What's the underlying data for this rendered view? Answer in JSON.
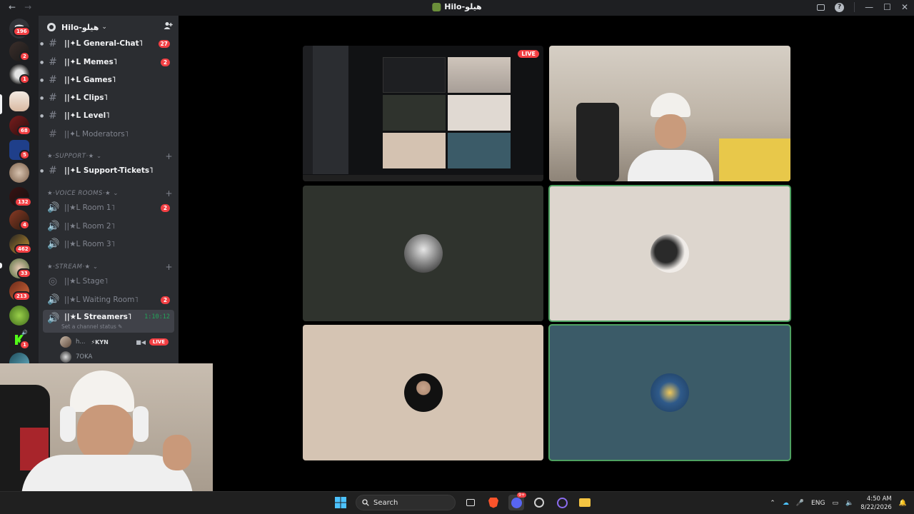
{
  "window": {
    "title": "Hilo-هيلو",
    "back": "←",
    "forward": "→",
    "controls": {
      "minimize": "—",
      "maximize": "☐",
      "close": "✕",
      "help": "?"
    }
  },
  "rail": {
    "badges": [
      "196",
      "2",
      "1",
      "68",
      "5",
      "132",
      "4",
      "462",
      "33",
      "213",
      "1"
    ]
  },
  "server": {
    "name": "Hilo-هيلو",
    "chevron": "⌄",
    "invite_icon": "👤+"
  },
  "channels": {
    "general": {
      "label": "||✦L General-Chat˥",
      "count": "27"
    },
    "memes": {
      "label": "||✦L Memes˥",
      "count": "2"
    },
    "games": {
      "label": "||✦L Games˥"
    },
    "clips": {
      "label": "||✦L Clips˥"
    },
    "level": {
      "label": "||✦L Level˥"
    },
    "moderators": {
      "label": "||✦L Moderators˥"
    }
  },
  "categories": {
    "support": "★·SUPPORT·★ ⌄",
    "voice": "★·VOICE ROOMS·★ ⌄",
    "stream": "★·STREAM·★ ⌄"
  },
  "support": {
    "tickets": {
      "label": "||✦L Support-Tickets˥"
    }
  },
  "voice": {
    "room1": {
      "label": "||★L Room 1˥",
      "count": "2"
    },
    "room2": {
      "label": "||★L Room 2˥"
    },
    "room3": {
      "label": "||★L Room 3˥"
    }
  },
  "stream": {
    "stage": {
      "label": "||★L Stage˥"
    },
    "waiting": {
      "label": "||★L Waiting Room˥",
      "count": "2"
    },
    "streamers": {
      "label": "||★L Streamers˥",
      "timer": "1:10:12",
      "status": "Set a channel status ✎"
    }
  },
  "members": [
    {
      "name": "h...",
      "tag": "⚡KYN",
      "live": "LIVE"
    },
    {
      "name": "7OKA"
    }
  ],
  "stage": {
    "live_label": "LIVE"
  },
  "taskbar": {
    "search_label": "Search",
    "lang": "ENG",
    "time": "4:50 AM",
    "date": "8/22/2026",
    "discord_badge": "9+"
  }
}
